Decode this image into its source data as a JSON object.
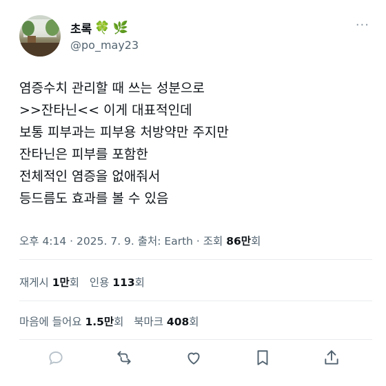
{
  "author": {
    "display_name": "초록",
    "emoji_1": "🍀",
    "emoji_2": "🌿",
    "handle": "@po_may23",
    "avatar_icon": "profile-photo"
  },
  "more_label": "···",
  "tweet_lines": [
    "염증수치 관리할 때 쓰는 성분으로",
    ">>잔타닌<< 이게 대표적인데",
    "보통 피부과는 피부용 처방약만 주지만",
    "잔타닌은 피부를 포함한",
    "전체적인 염증을 없애줘서",
    "등드름도 효과를 볼 수 있음"
  ],
  "meta": {
    "time_source_prefix": "오후 4:14 · 2025. 7. 9. 출처: Earth · 조회 ",
    "views_value": "86만",
    "views_suffix": "회"
  },
  "stats": {
    "retweet_label": "재게시",
    "retweet_value": "1만",
    "retweet_suffix": "회",
    "quote_label": "인용",
    "quote_value": "113",
    "quote_suffix": "회",
    "like_label": "마음에 들어요",
    "like_value": "1.5만",
    "like_suffix": "회",
    "bookmark_label": "북마크",
    "bookmark_value": "408",
    "bookmark_suffix": "회"
  },
  "actions": [
    "reply-icon",
    "retweet-icon",
    "like-icon",
    "bookmark-icon",
    "share-icon"
  ],
  "colors": {
    "text": "#0f1419",
    "secondary": "#536471",
    "divider": "#e7ebee"
  }
}
